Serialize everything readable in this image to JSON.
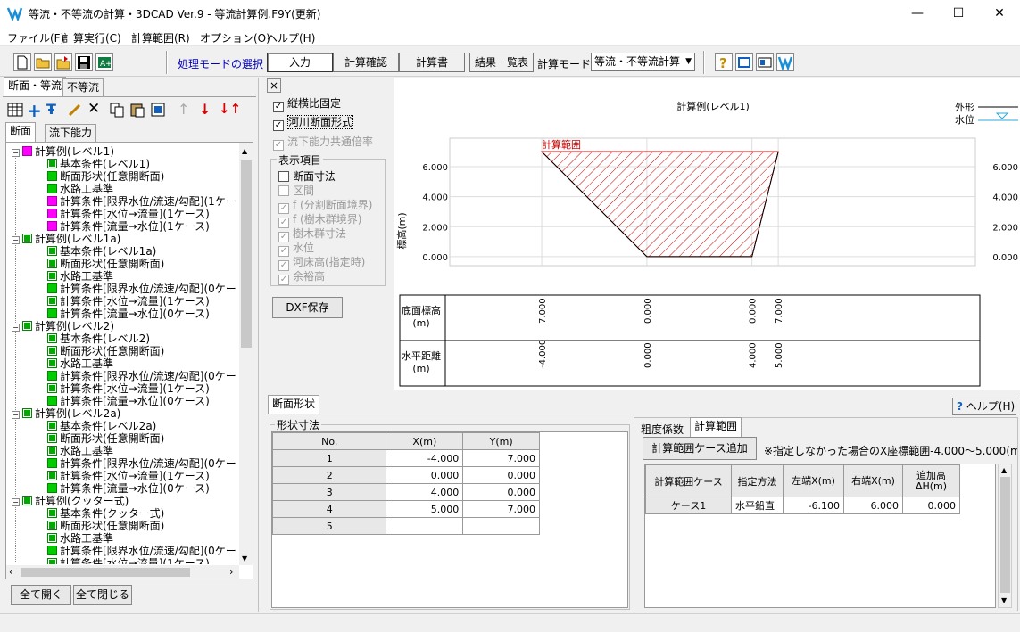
{
  "window": {
    "title": "等流・不等流の計算・3DCAD Ver.9 - 等流計算例.F9Y(更新)"
  },
  "menu": [
    "ファイル(F)",
    "計算実行(C)",
    "計算範囲(R)",
    "オプション(O)",
    "ヘルプ(H)"
  ],
  "toolbar": {
    "mode_label": "処理モードの選択",
    "modes": [
      "入力",
      "計算確認",
      "計算書",
      "結果一覧表"
    ],
    "calc_mode_label": "計算モード",
    "calc_mode_value": "等流・不等流計算"
  },
  "left": {
    "tabs": [
      "断面・等流",
      "不等流"
    ],
    "subtabs": [
      "断面",
      "流下能力"
    ],
    "tree": [
      {
        "label": "計算例(レベル1)",
        "icon": "mag",
        "children": [
          {
            "label": "基本条件(レベル1)",
            "c": "gcheck"
          },
          {
            "label": "断面形状(任意開断面)",
            "c": "green"
          },
          {
            "label": "水路工基準",
            "c": "green"
          },
          {
            "label": "計算条件[限界水位/流速/勾配](1ケー",
            "c": "mag"
          },
          {
            "label": "計算条件[水位→流量](1ケース)",
            "c": "mag"
          },
          {
            "label": "計算条件[流量→水位](1ケース)",
            "c": "mag"
          }
        ]
      },
      {
        "label": "計算例(レベル1a)",
        "icon": "gcheck",
        "children": [
          {
            "label": "基本条件(レベル1a)",
            "c": "gcheck"
          },
          {
            "label": "断面形状(任意開断面)",
            "c": "gcheck"
          },
          {
            "label": "水路工基準",
            "c": "gcheck"
          },
          {
            "label": "計算条件[限界水位/流速/勾配](0ケー",
            "c": "green"
          },
          {
            "label": "計算条件[水位→流量](1ケース)",
            "c": "gcheck"
          },
          {
            "label": "計算条件[流量→水位](0ケース)",
            "c": "green"
          }
        ]
      },
      {
        "label": "計算例(レベル2)",
        "icon": "gcheck",
        "children": [
          {
            "label": "基本条件(レベル2)",
            "c": "gcheck"
          },
          {
            "label": "断面形状(任意開断面)",
            "c": "gcheck"
          },
          {
            "label": "水路工基準",
            "c": "gcheck"
          },
          {
            "label": "計算条件[限界水位/流速/勾配](0ケー",
            "c": "green"
          },
          {
            "label": "計算条件[水位→流量](1ケース)",
            "c": "gcheck"
          },
          {
            "label": "計算条件[流量→水位](0ケース)",
            "c": "green"
          }
        ]
      },
      {
        "label": "計算例(レベル2a)",
        "icon": "gcheck",
        "children": [
          {
            "label": "基本条件(レベル2a)",
            "c": "gcheck"
          },
          {
            "label": "断面形状(任意開断面)",
            "c": "gcheck"
          },
          {
            "label": "水路工基準",
            "c": "gcheck"
          },
          {
            "label": "計算条件[限界水位/流速/勾配](0ケー",
            "c": "green"
          },
          {
            "label": "計算条件[水位→流量](1ケース)",
            "c": "gcheck"
          },
          {
            "label": "計算条件[流量→水位](0ケース)",
            "c": "green"
          }
        ]
      },
      {
        "label": "計算例(クッター式)",
        "icon": "gcheck",
        "children": [
          {
            "label": "基本条件(クッター式)",
            "c": "gcheck"
          },
          {
            "label": "断面形状(任意開断面)",
            "c": "gcheck"
          },
          {
            "label": "水路工基準",
            "c": "gcheck"
          },
          {
            "label": "計算条件[限界水位/流速/勾配](0ケー",
            "c": "green"
          },
          {
            "label": "計算条件[水位→流量](1ケース)",
            "c": "gcheck"
          }
        ]
      }
    ],
    "expand_all": "全て開く",
    "collapse_all": "全て閉じる"
  },
  "options": {
    "close": "×",
    "fixed_ratio": "縦横比固定",
    "river_shape": "河川断面形式",
    "common_rate": "流下能力共通倍率",
    "display_group": "表示項目",
    "items": [
      "断面寸法",
      "区間",
      "f (分割断面境界)",
      "f (樹木群境界)",
      "樹木群寸法",
      "水位",
      "河床高(指定時)",
      "余裕高"
    ],
    "dxf": "DXF保存"
  },
  "chart": {
    "title": "計算例(レベル1)",
    "range_label": "計算範囲",
    "legend_outline": "外形",
    "legend_water": "水位",
    "ylabel": "標高(m)",
    "yticks": [
      "6.000",
      "4.000",
      "2.000",
      "0.000"
    ],
    "yticks_right": [
      "6.000",
      "4.000",
      "2.000",
      "0.000"
    ],
    "row1_label": "底面標高(m)",
    "row2_label": "水平距離(m)",
    "row1_values": [
      "7.000",
      "0.000",
      "0.000",
      "7.000"
    ],
    "row2_values": [
      "-4.000",
      "0.000",
      "4.000",
      "5.000"
    ]
  },
  "chart_data": {
    "type": "area",
    "x": [
      -4,
      0,
      4,
      5
    ],
    "y": [
      7,
      0,
      0,
      7
    ],
    "ylim": [
      0,
      8
    ]
  },
  "bottom": {
    "tab": "断面形状",
    "help": "ヘルプ(H)",
    "shape_group": "形状寸法",
    "table_headers": [
      "No.",
      "X(m)",
      "Y(m)"
    ],
    "rows": [
      [
        "1",
        "-4.000",
        "7.000"
      ],
      [
        "2",
        "0.000",
        "0.000"
      ],
      [
        "3",
        "4.000",
        "0.000"
      ],
      [
        "4",
        "5.000",
        "7.000"
      ],
      [
        "5",
        "",
        ""
      ]
    ],
    "right_tabs": [
      "粗度係数",
      "計算範囲"
    ],
    "add_case": "計算範囲ケース追加",
    "note": "※指定しなかった場合のX座標範囲-4.000〜5.000(m",
    "range_headers": [
      "計算範囲ケース",
      "指定方法",
      "左端X(m)",
      "右端X(m)",
      "追加高ΔH(m)"
    ],
    "range_rows": [
      [
        "ケース1",
        "水平鉛直",
        "-6.100",
        "6.000",
        "0.000"
      ]
    ]
  }
}
